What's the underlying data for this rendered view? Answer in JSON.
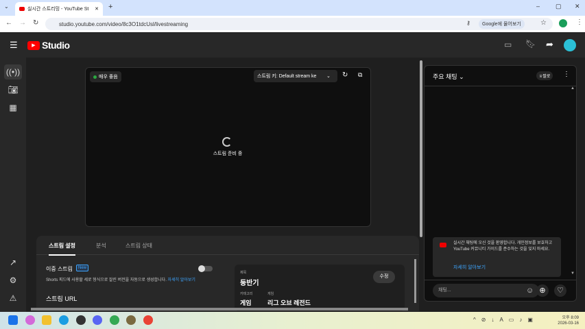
{
  "browser": {
    "tab_title": "실시간 스트리밍 - YouTube St",
    "url": "studio.youtube.com/video/8c3O1tdcUsl/livestreaming",
    "ask_google": "Google에 물어보기"
  },
  "header": {
    "logo": "Studio"
  },
  "preview": {
    "status": "매우 좋음",
    "stream_key": "스트림 키: Default stream ke",
    "loading": "스트림 준비 중"
  },
  "bottom": {
    "tabs": [
      "스트림 설정",
      "분석",
      "스트림 상태"
    ],
    "dual_stream": "이중 스트림",
    "new_badge": "New",
    "dual_desc": "Shorts 피드에 사용할 세로 형식으로 잘린 버전을 자동으로 생성합니다.",
    "learn_more": "자세히 알아보기",
    "stream_url": "스트림 URL",
    "title_label": "제목",
    "title": "둥반기",
    "edit": "수정",
    "category_label": "카테고리",
    "category": "게임",
    "game_label": "게임",
    "game": "리그 오브 레전드"
  },
  "chat": {
    "title": "주요 채팅",
    "top_fan": "팔로",
    "welcome": "실시간 채팅에 오신 것을 환영합니다. 개인정보를 보호하고 YouTube 커뮤니티 가이드를 준수하는 것을 잊지 마세요.",
    "learn_more": "자세히 알아보기",
    "placeholder": "채팅..."
  },
  "taskbar": {
    "time": "오후 8:09",
    "date": "2026-03-16"
  },
  "colors": {
    "accent": "#3ea6ff",
    "live": "#2ba640",
    "brand": "#ff0000"
  }
}
